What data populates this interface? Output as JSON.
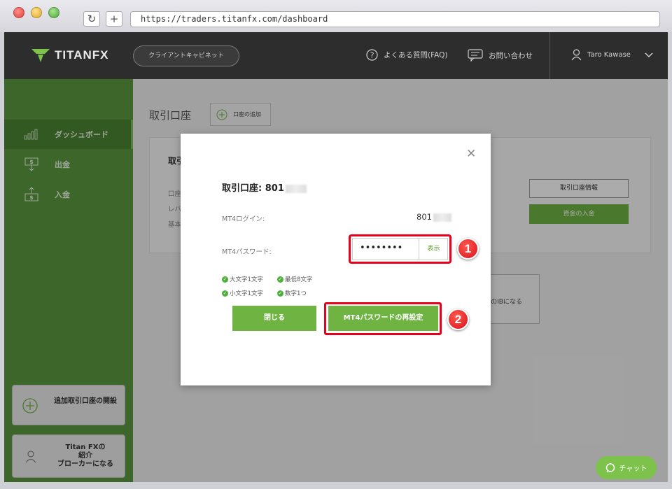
{
  "browser": {
    "url": "https://traders.titanfx.com/dashboard"
  },
  "header": {
    "logo_text": "TITANFX",
    "client_cabinet": "クライアントキャビネット",
    "faq": "よくある質問(FAQ)",
    "contact": "お問い合わせ",
    "user_name": "Taro Kawase"
  },
  "sidebar": {
    "items": [
      {
        "label": "ダッシュボード",
        "icon": "bar-chart-icon"
      },
      {
        "label": "出金",
        "icon": "withdraw-icon"
      },
      {
        "label": "入金",
        "icon": "deposit-icon"
      }
    ],
    "open_account": "追加取引口座の開設",
    "ib_line1": "Titan FXの",
    "ib_line2": "紹介",
    "ib_line3": "ブローカーになる"
  },
  "main": {
    "title": "取引口座",
    "add_account": "口座の追加",
    "card_title": "取引",
    "card_labels": [
      "口座",
      "レバ",
      "基本"
    ],
    "info_button": "取引口座情報",
    "deposit_button": "資金の入金",
    "ib_text": "のIBになる"
  },
  "modal": {
    "title": "取引口座: 801",
    "login_label": "MT4ログイン:",
    "login_value": "801",
    "password_label": "MT4パスワード:",
    "password_value": "••••••••",
    "show_label": "表示",
    "rules": [
      "大文字1文字",
      "最低8文字",
      "小文字1文字",
      "数字1つ"
    ],
    "close_button": "閉じる",
    "reset_button": "MT4パスワードの再設定",
    "step1": "1",
    "step2": "2"
  },
  "chat": {
    "label": "チャット"
  },
  "colors": {
    "accent": "#6fb443",
    "sidebar": "#5b9a3f",
    "highlight": "#e8001c",
    "header": "#2d2d2d"
  }
}
